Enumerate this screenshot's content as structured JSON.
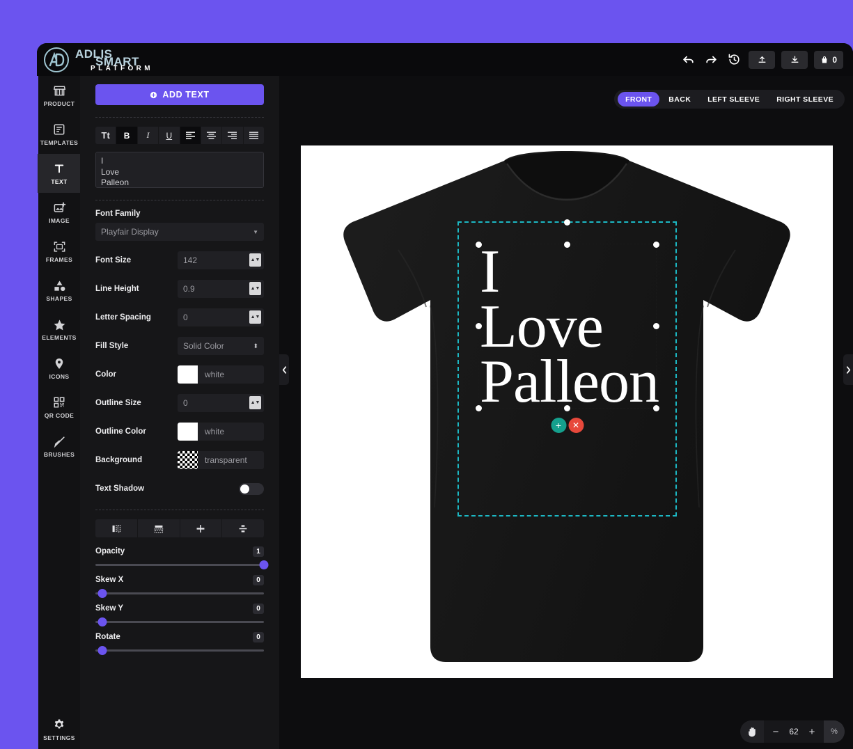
{
  "brand": {
    "line1": "ADLIS",
    "line2": "SMART",
    "line3": "PLATFORM",
    "logo_icon": "ad-monogram-icon"
  },
  "header": {
    "undo_icon": "undo-icon",
    "redo_icon": "redo-icon",
    "history_icon": "history-clock-icon",
    "upload_icon": "upload-icon",
    "download_icon": "download-icon",
    "cart_icon": "cart-icon",
    "cart_count": "0"
  },
  "rail": {
    "items": [
      {
        "label": "PRODUCT",
        "icon": "store-icon",
        "active": false
      },
      {
        "label": "TEMPLATES",
        "icon": "template-icon",
        "active": false
      },
      {
        "label": "TEXT",
        "icon": "text-t-icon",
        "active": true
      },
      {
        "label": "IMAGE",
        "icon": "image-add-icon",
        "active": false
      },
      {
        "label": "FRAMES",
        "icon": "frame-icon",
        "active": false
      },
      {
        "label": "SHAPES",
        "icon": "shapes-icon",
        "active": false
      },
      {
        "label": "ELEMENTS",
        "icon": "star-icon",
        "active": false
      },
      {
        "label": "ICONS",
        "icon": "map-pin-icon",
        "active": false
      },
      {
        "label": "QR CODE",
        "icon": "qr-code-icon",
        "active": false
      },
      {
        "label": "BRUSHES",
        "icon": "brush-icon",
        "active": false
      }
    ],
    "settings": {
      "label": "SETTINGS",
      "icon": "gear-icon"
    }
  },
  "panel": {
    "add_text_label": "ADD TEXT",
    "add_text_icon": "plus-circle-icon",
    "format_buttons": [
      {
        "name": "text-transform",
        "glyph": "Tt",
        "active": false
      },
      {
        "name": "bold",
        "glyph": "B",
        "active": true
      },
      {
        "name": "italic",
        "glyph": "I",
        "active": false
      },
      {
        "name": "underline",
        "glyph": "U",
        "active": false
      },
      {
        "name": "align-left",
        "glyph": "",
        "active": true
      },
      {
        "name": "align-center",
        "glyph": "",
        "active": false
      },
      {
        "name": "align-right",
        "glyph": "",
        "active": false
      },
      {
        "name": "align-justify",
        "glyph": "",
        "active": false
      }
    ],
    "text_value": "I\nLove\nPalleon",
    "fields": {
      "font_family_label": "Font Family",
      "font_family_value": "Playfair Display",
      "font_size_label": "Font Size",
      "font_size_value": "142",
      "line_height_label": "Line Height",
      "line_height_value": "0.9",
      "letter_spacing_label": "Letter Spacing",
      "letter_spacing_value": "0",
      "fill_style_label": "Fill Style",
      "fill_style_value": "Solid Color",
      "color_label": "Color",
      "color_value": "white",
      "outline_size_label": "Outline Size",
      "outline_size_value": "0",
      "outline_color_label": "Outline Color",
      "outline_color_value": "white",
      "background_label": "Background",
      "background_value": "transparent",
      "text_shadow_label": "Text Shadow",
      "text_shadow_on": false
    },
    "align_tools": [
      {
        "name": "flip-horizontal-icon"
      },
      {
        "name": "flip-vertical-icon"
      },
      {
        "name": "center-horizontal-icon"
      },
      {
        "name": "center-vertical-icon"
      }
    ],
    "sliders": [
      {
        "label": "Opacity",
        "value": "1",
        "pct": 100
      },
      {
        "label": "Skew X",
        "value": "0",
        "pct": 4
      },
      {
        "label": "Skew Y",
        "value": "0",
        "pct": 4
      },
      {
        "label": "Rotate",
        "value": "0",
        "pct": 4
      }
    ]
  },
  "canvas": {
    "view_tabs": [
      {
        "label": "FRONT",
        "active": true
      },
      {
        "label": "BACK",
        "active": false
      },
      {
        "label": "LEFT SLEEVE",
        "active": false
      },
      {
        "label": "RIGHT SLEEVE",
        "active": false
      }
    ],
    "design_lines": [
      "I",
      "Love",
      "Palleon"
    ],
    "add_button_icon": "plus-icon",
    "delete_button_icon": "close-x-icon",
    "collapse_left_icon": "chevron-left-icon",
    "collapse_right_icon": "chevron-right-icon",
    "zoom": {
      "hand_icon": "hand-icon",
      "minus_label": "−",
      "value": "62",
      "plus_label": "+",
      "percent_label": "%"
    },
    "colors": {
      "print_area_border": "#1cb8c4",
      "accent": "#6b54ef",
      "add_button": "#15a08d",
      "delete_button": "#e7483b",
      "shirt": "#1b1b1b"
    }
  }
}
